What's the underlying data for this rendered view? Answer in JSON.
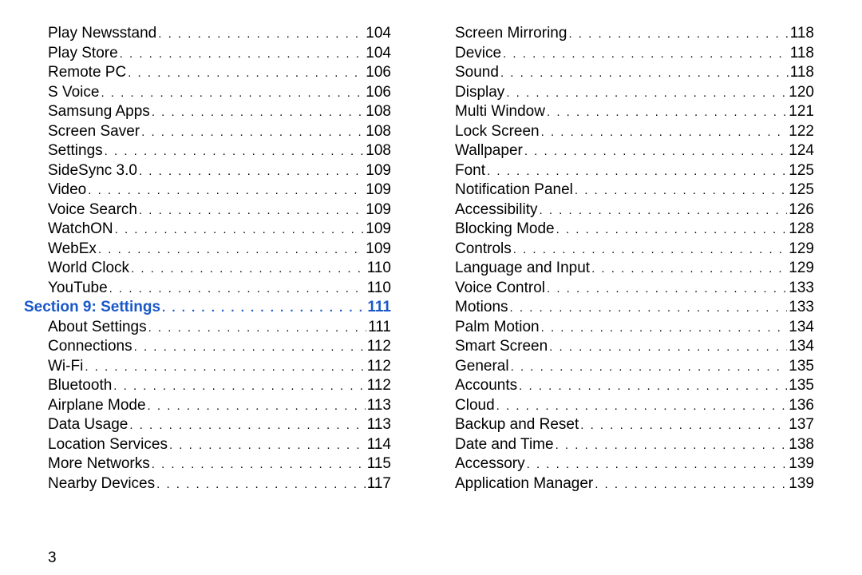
{
  "page_number": "3",
  "left_column": [
    {
      "type": "entry",
      "label": "Play Newsstand",
      "page": "104"
    },
    {
      "type": "entry",
      "label": "Play Store",
      "page": "104"
    },
    {
      "type": "entry",
      "label": "Remote PC",
      "page": "106"
    },
    {
      "type": "entry",
      "label": "S Voice",
      "page": "106"
    },
    {
      "type": "entry",
      "label": "Samsung Apps",
      "page": "108"
    },
    {
      "type": "entry",
      "label": "Screen Saver",
      "page": "108"
    },
    {
      "type": "entry",
      "label": "Settings",
      "page": "108"
    },
    {
      "type": "entry",
      "label": "SideSync 3.0",
      "page": "109"
    },
    {
      "type": "entry",
      "label": "Video",
      "page": "109"
    },
    {
      "type": "entry",
      "label": "Voice Search",
      "page": "109"
    },
    {
      "type": "entry",
      "label": "WatchON",
      "page": "109"
    },
    {
      "type": "entry",
      "label": "WebEx",
      "page": "109"
    },
    {
      "type": "entry",
      "label": "World Clock",
      "page": "110"
    },
    {
      "type": "entry",
      "label": "YouTube",
      "page": "110"
    },
    {
      "type": "section",
      "label": "Section 9:  Settings",
      "page": "111"
    },
    {
      "type": "entry",
      "label": "About Settings",
      "page": "111"
    },
    {
      "type": "entry",
      "label": "Connections",
      "page": "112"
    },
    {
      "type": "entry",
      "label": "Wi-Fi",
      "page": "112"
    },
    {
      "type": "entry",
      "label": "Bluetooth",
      "page": "112"
    },
    {
      "type": "entry",
      "label": "Airplane Mode",
      "page": "113"
    },
    {
      "type": "entry",
      "label": "Data Usage",
      "page": "113"
    },
    {
      "type": "entry",
      "label": "Location Services",
      "page": "114"
    },
    {
      "type": "entry",
      "label": "More Networks",
      "page": "115"
    },
    {
      "type": "entry",
      "label": "Nearby Devices",
      "page": "117"
    }
  ],
  "right_column": [
    {
      "type": "entry",
      "label": "Screen Mirroring",
      "page": "118"
    },
    {
      "type": "entry",
      "label": "Device",
      "page": "118"
    },
    {
      "type": "entry",
      "label": "Sound",
      "page": "118"
    },
    {
      "type": "entry",
      "label": "Display",
      "page": "120"
    },
    {
      "type": "entry",
      "label": "Multi Window",
      "page": "121"
    },
    {
      "type": "entry",
      "label": "Lock Screen",
      "page": "122"
    },
    {
      "type": "entry",
      "label": "Wallpaper",
      "page": "124"
    },
    {
      "type": "entry",
      "label": "Font",
      "page": "125"
    },
    {
      "type": "entry",
      "label": "Notification Panel",
      "page": "125"
    },
    {
      "type": "entry",
      "label": "Accessibility",
      "page": "126"
    },
    {
      "type": "entry",
      "label": "Blocking Mode",
      "page": "128"
    },
    {
      "type": "entry",
      "label": "Controls",
      "page": "129"
    },
    {
      "type": "entry",
      "label": "Language and Input",
      "page": "129"
    },
    {
      "type": "entry",
      "label": "Voice Control",
      "page": "133"
    },
    {
      "type": "entry",
      "label": "Motions",
      "page": "133"
    },
    {
      "type": "entry",
      "label": "Palm Motion",
      "page": "134"
    },
    {
      "type": "entry",
      "label": "Smart Screen",
      "page": "134"
    },
    {
      "type": "entry",
      "label": "General",
      "page": "135"
    },
    {
      "type": "entry",
      "label": "Accounts",
      "page": "135"
    },
    {
      "type": "entry",
      "label": "Cloud",
      "page": "136"
    },
    {
      "type": "entry",
      "label": "Backup and Reset",
      "page": "137"
    },
    {
      "type": "entry",
      "label": "Date and Time",
      "page": "138"
    },
    {
      "type": "entry",
      "label": "Accessory",
      "page": "139"
    },
    {
      "type": "entry",
      "label": "Application Manager",
      "page": "139"
    }
  ]
}
